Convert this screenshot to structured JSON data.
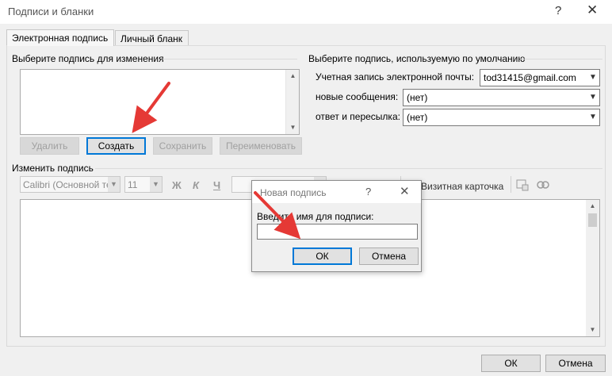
{
  "window": {
    "title": "Подписи и бланки",
    "help_glyph": "?",
    "close_glyph": "✕"
  },
  "tabs": [
    {
      "label": "Электронная подпись",
      "active": true
    },
    {
      "label": "Личный бланк",
      "active": false
    }
  ],
  "select_section": {
    "label": "Выберите подпись для изменения",
    "buttons": {
      "delete": "Удалить",
      "create": "Создать",
      "save": "Сохранить",
      "rename": "Переименовать"
    }
  },
  "default_section": {
    "label": "Выберите подпись, используемую по умолчанию",
    "account_label": "Учетная запись электронной почты:",
    "account_value": "tod31415@gmail.com",
    "new_messages_label": "новые сообщения:",
    "new_messages_value": "(нет)",
    "replies_label": "ответ и пересылка:",
    "replies_value": "(нет)"
  },
  "edit_section": {
    "label": "Изменить подпись",
    "font_value": "Calibri (Основной те",
    "size_value": "11",
    "bold": "Ж",
    "italic": "К",
    "underline": "Ч",
    "business_card": "Визитная карточка"
  },
  "new_signature_dialog": {
    "title": "Новая подпись",
    "help_glyph": "?",
    "close_glyph": "✕",
    "prompt": "Введите имя для подписи:",
    "input_value": "",
    "ok": "ОК",
    "cancel": "Отмена"
  },
  "footer": {
    "ok": "ОК",
    "cancel": "Отмена"
  },
  "colors": {
    "arrow": "#e53935",
    "focus": "#0078d7"
  }
}
